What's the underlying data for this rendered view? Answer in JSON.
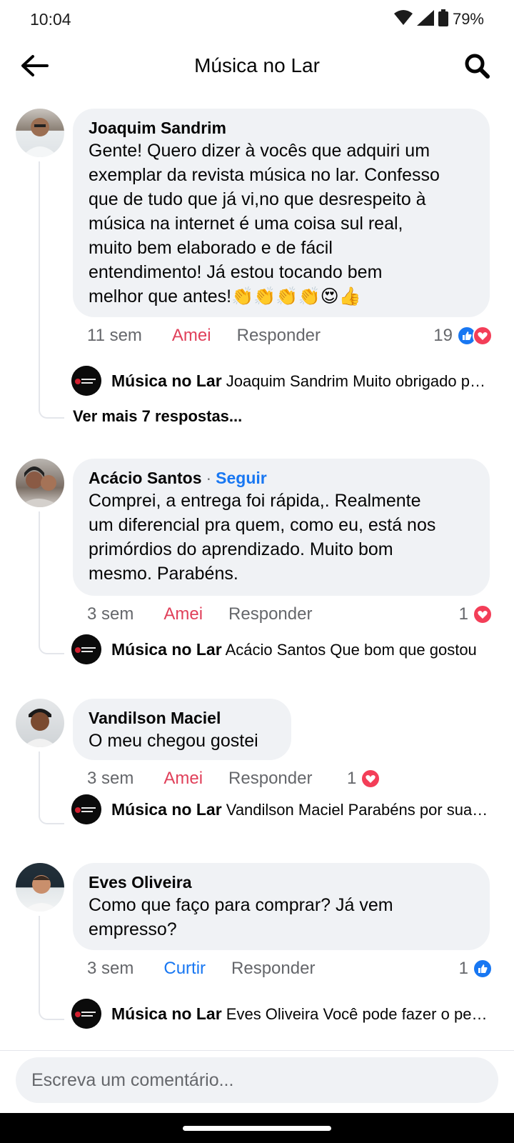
{
  "status": {
    "time": "10:04",
    "battery": "79%"
  },
  "header": {
    "title": "Música no Lar"
  },
  "comments": [
    {
      "author": "Joaquim Sandrim",
      "text": "Gente! Quero dizer à vocês que adquiri um\nexemplar da revista música no lar. Confesso\nque de tudo que já vi,no que desrespeito à\nmúsica na internet é uma coisa sul real,\nmuito bem elaborado e de fácil\nentendimento! Já estou tocando bem\nmelhor que antes!👏👏👏👏😍👍",
      "time": "11 sem",
      "reaction_label": "Amei",
      "reply_label": "Responder",
      "reaction_count": "19",
      "reply_preview": {
        "author": "Música no Lar",
        "text": "Joaquim Sandrim Muito obrigado pelo seu comentário"
      },
      "more_replies": "Ver mais 7 respostas..."
    },
    {
      "author": "Acácio Santos",
      "follow_label": "Seguir",
      "text": "Comprei, a entrega foi rápida,. Realmente\num diferencial pra quem, como eu, está nos\nprimórdios do aprendizado. Muito bom\nmesmo. Parabéns.",
      "time": "3 sem",
      "reaction_label": "Amei",
      "reply_label": "Responder",
      "reaction_count": "1",
      "reply_preview": {
        "author": "Música no Lar",
        "text": "Acácio Santos Que bom que gostou"
      }
    },
    {
      "author": "Vandilson Maciel",
      "text": "O meu chegou gostei",
      "time": "3 sem",
      "reaction_label": "Amei",
      "reply_label": "Responder",
      "reaction_count": "1",
      "reply_preview": {
        "author": "Música no Lar",
        "text": "Vandilson Maciel Parabéns por sua compra"
      }
    },
    {
      "author": "Eves Oliveira",
      "text": "Como que faço para comprar? Já vem\nempresso?",
      "time": "3 sem",
      "reaction_label": "Curtir",
      "reply_label": "Responder",
      "reaction_count": "1",
      "reply_preview": {
        "author": "Música no Lar",
        "text": "Eves Oliveira Você pode fazer o pedido pelo link"
      }
    }
  ],
  "composer": {
    "placeholder": "Escreva um comentário..."
  },
  "colors": {
    "love": "#f33e58",
    "like": "#1877f2",
    "bubble": "#f0f2f5"
  }
}
